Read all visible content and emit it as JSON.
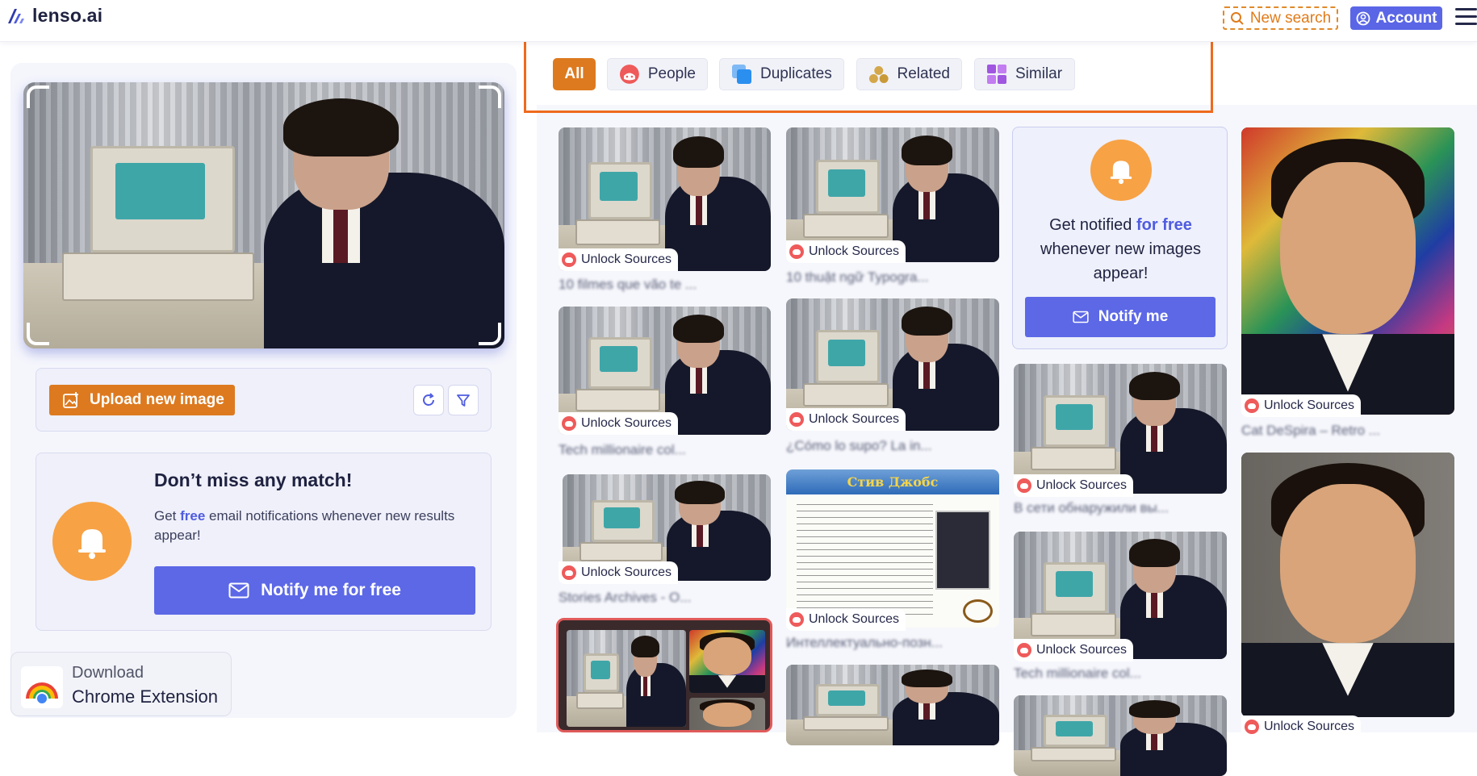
{
  "header": {
    "logo_text": "lenso.ai",
    "new_search_label": "New search",
    "account_label": "Account"
  },
  "left": {
    "upload_label": "Upload new image",
    "notify_title": "Don’t miss any match!",
    "notify_desc_pre": "Get ",
    "notify_desc_free": "free",
    "notify_desc_post": " email notifications whenever new results appear!",
    "notify_button": "Notify me for free",
    "chrome_line1": "Download",
    "chrome_line2": "Chrome Extension"
  },
  "tabs": [
    {
      "label": "All",
      "active": true
    },
    {
      "label": "People",
      "active": false
    },
    {
      "label": "Duplicates",
      "active": false
    },
    {
      "label": "Related",
      "active": false
    },
    {
      "label": "Similar",
      "active": false
    }
  ],
  "results": {
    "unlock_label": "Unlock Sources",
    "captions": [
      "10 filmes que vão te ...",
      "Tech millionaire col...",
      "Stories Archives - O...",
      "10 thuật ngữ Typogra...",
      "¿Cómo lo supo? La in...",
      "Интеллектуально-позн...",
      "В сети обнаружили вы...",
      "Tech millionaire col...",
      "Cat DeSpira – Retro ..."
    ],
    "doc_banner": "Стив Джобс"
  },
  "notify_card": {
    "msg_pre": "Get notified ",
    "msg_free": "for free",
    "msg_post": " whenever new images appear!",
    "button": "Notify me"
  },
  "colors": {
    "accent_orange": "#dd7a1f",
    "accent_blue": "#5c68e6",
    "highlight_frame": "#ee6a1d"
  }
}
